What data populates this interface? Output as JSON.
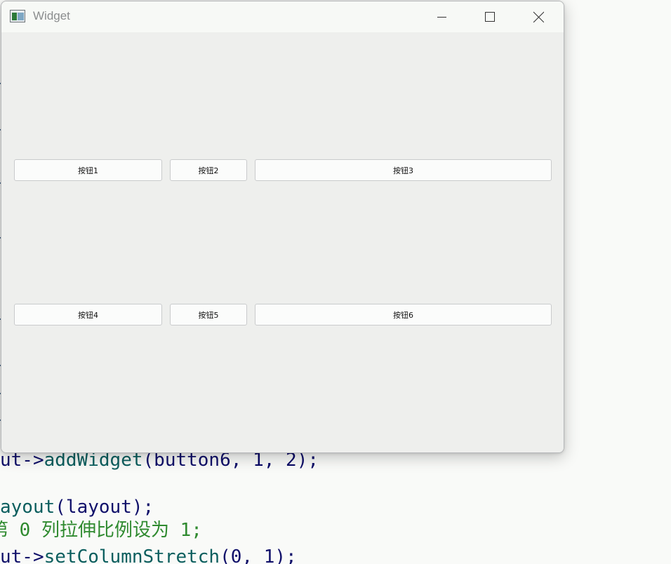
{
  "window": {
    "title": "Widget",
    "icon": "qt-app-icon"
  },
  "buttons": [
    {
      "label": "按钮1"
    },
    {
      "label": "按钮2"
    },
    {
      "label": "按钮3"
    },
    {
      "label": "按钮4"
    },
    {
      "label": "按钮5"
    },
    {
      "label": "按钮6"
    }
  ],
  "editor": {
    "line_add": {
      "prefix": "ut->",
      "fn": "addWidget",
      "args": "(button6, ",
      "n1": "1",
      "sep": ", ",
      "n2": "2",
      "tail": ");"
    },
    "line_layout": {
      "fn": "ayout",
      "args": "(layout);"
    },
    "line_comment": {
      "text": "第 0 列拉伸比例设为 1;"
    },
    "line_stretch": {
      "prefix": "ut->",
      "fn": "setColumnStretch",
      "args": "(0, 1);"
    }
  },
  "colors": {
    "window_bg": "#eeefed",
    "titlebar_bg": "#f7f9f6",
    "button_bg": "#fbfcfb",
    "button_border": "#c9cbcc",
    "comment": "#2f8a2f",
    "function": "#0b5e5e"
  }
}
